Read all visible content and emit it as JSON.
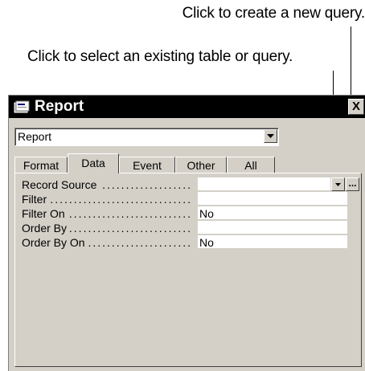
{
  "callouts": {
    "new_query": "Click to create a new query.",
    "existing": "Click to select an existing table or query."
  },
  "window": {
    "title": "Report",
    "close_label": "X",
    "object_select_value": "Report"
  },
  "tabs": [
    {
      "label": "Format",
      "active": false
    },
    {
      "label": "Data",
      "active": true
    },
    {
      "label": "Event",
      "active": false
    },
    {
      "label": "Other",
      "active": false
    },
    {
      "label": "All",
      "active": false
    }
  ],
  "properties": [
    {
      "label": "Record Source",
      "value": ""
    },
    {
      "label": "Filter",
      "value": ""
    },
    {
      "label": "Filter On",
      "value": "No"
    },
    {
      "label": "Order By",
      "value": ""
    },
    {
      "label": "Order By On",
      "value": "No"
    }
  ],
  "record_source_buttons": {
    "dropdown_icon": "chevron-down-icon",
    "builder_label": "..."
  }
}
